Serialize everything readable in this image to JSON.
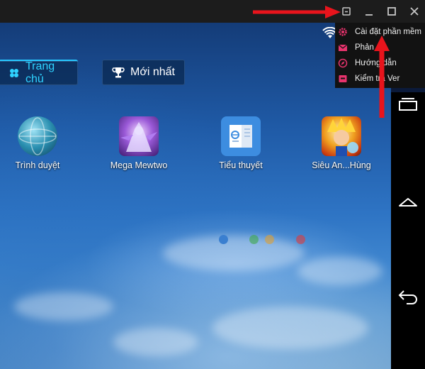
{
  "tabs": [
    {
      "label": "Trang chủ",
      "active": true
    },
    {
      "label": "Mới nhất",
      "active": false
    }
  ],
  "apps": [
    {
      "label": "Trình duyệt",
      "icon": "globe-icon"
    },
    {
      "label": "Mega Mewtwo",
      "icon": "mewtwo-game-icon"
    },
    {
      "label": "Tiểu thuyết",
      "icon": "ebook-icon"
    },
    {
      "label": "Siêu An...Hùng",
      "icon": "dragon-ball-game-icon"
    }
  ],
  "menu": {
    "items": [
      {
        "label": "Cài đặt phần mềm",
        "icon": "gear-icon",
        "color": "#e8336d"
      },
      {
        "label": "Phản",
        "icon": "mail-icon",
        "color": "#e8336d"
      },
      {
        "label": "Hướng dẫn",
        "icon": "compass-icon",
        "color": "#e8336d"
      },
      {
        "label": "Kiểm tra Ver",
        "icon": "update-box-icon",
        "color": "#e8336d"
      }
    ]
  },
  "page_dots": [
    {
      "color": "#3a7fd0"
    },
    {
      "color": "#3fa84a"
    },
    {
      "color": "#e0a030"
    },
    {
      "color": "#e03a3a"
    }
  ],
  "colors": {
    "accent": "#2fd2ff",
    "annotation_arrow": "#e8141c",
    "titlebar": "#1c1c1c"
  }
}
